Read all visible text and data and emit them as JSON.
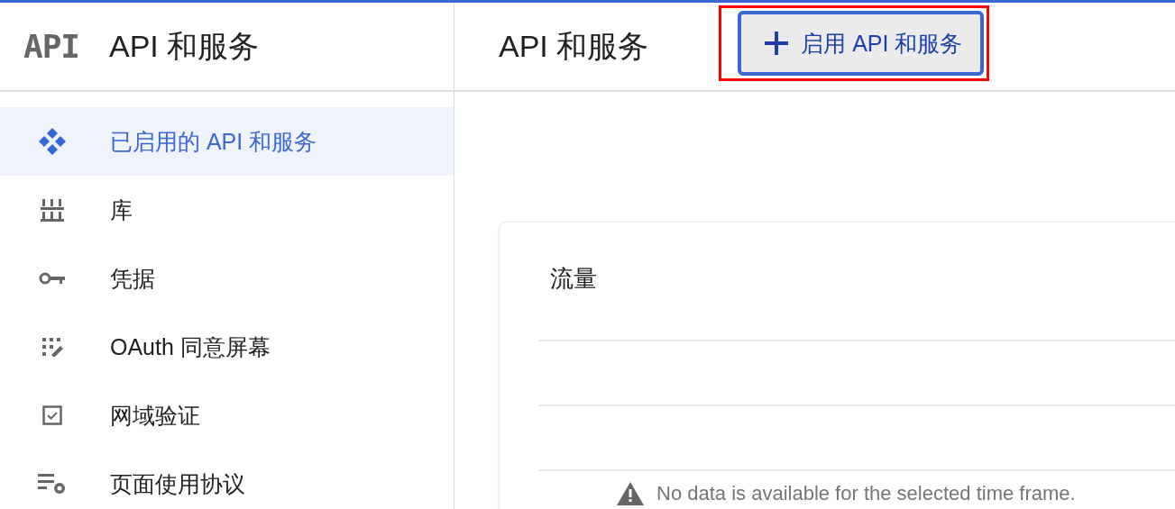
{
  "header": {
    "logo": "API",
    "product_title": "API 和服务",
    "page_title": "API 和服务",
    "enable_button": {
      "label": "启用 API 和服务",
      "focused": true,
      "highlighted": true
    }
  },
  "sidebar": {
    "items": [
      {
        "label": "已启用的 API 和服务",
        "selected": true
      },
      {
        "label": "库",
        "selected": false
      },
      {
        "label": "凭据",
        "selected": false
      },
      {
        "label": "OAuth 同意屏幕",
        "selected": false
      },
      {
        "label": "网域验证",
        "selected": false
      },
      {
        "label": "页面使用协议",
        "selected": false
      }
    ]
  },
  "traffic_card": {
    "title": "流量",
    "message": "No data is available for the selected time frame."
  }
}
